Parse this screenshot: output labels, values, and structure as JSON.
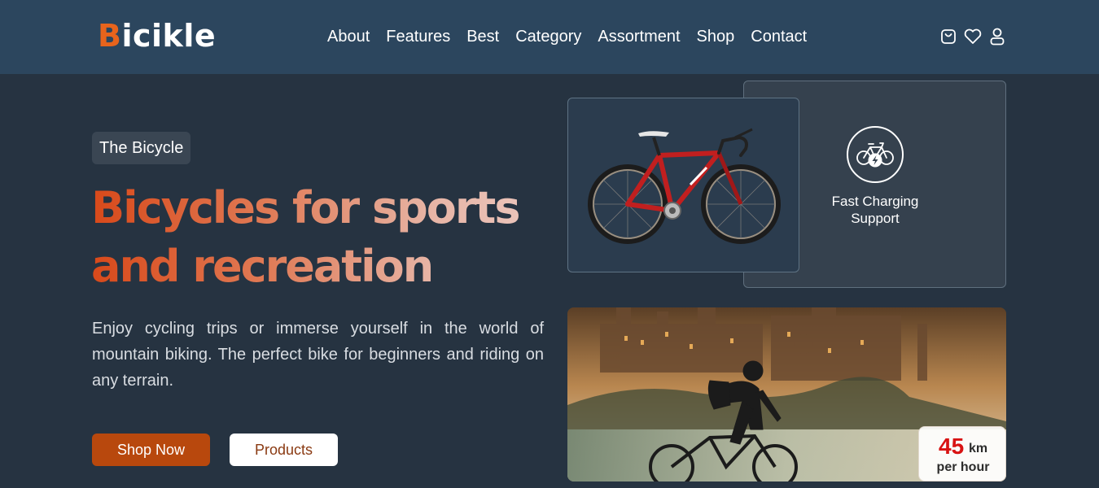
{
  "brand": {
    "first_letter": "B",
    "rest": "icikle"
  },
  "nav": {
    "links": [
      "About",
      "Features",
      "Best",
      "Category",
      "Assortment",
      "Shop",
      "Contact"
    ],
    "icons": [
      "cart-icon",
      "heart-icon",
      "user-icon"
    ]
  },
  "hero": {
    "tag": "The Bicycle",
    "title_line1": "Bicycles for sports",
    "title_line2": "and recreation",
    "description": "Enjoy cycling trips or immerse yourself in the world of mountain biking. The perfect bike for beginners and riding on any terrain.",
    "primary_button": "Shop Now",
    "secondary_button": "Products"
  },
  "feature": {
    "icon": "electric-bike-icon",
    "label": "Fast Charging Support"
  },
  "speed": {
    "value": "45",
    "unit": "km",
    "sub": "per hour"
  },
  "colors": {
    "accent": "#b8480d",
    "logo_accent": "#e8641c",
    "navbar_bg": "#2c465e",
    "page_bg": "#263341",
    "speed_value": "#d81313"
  }
}
